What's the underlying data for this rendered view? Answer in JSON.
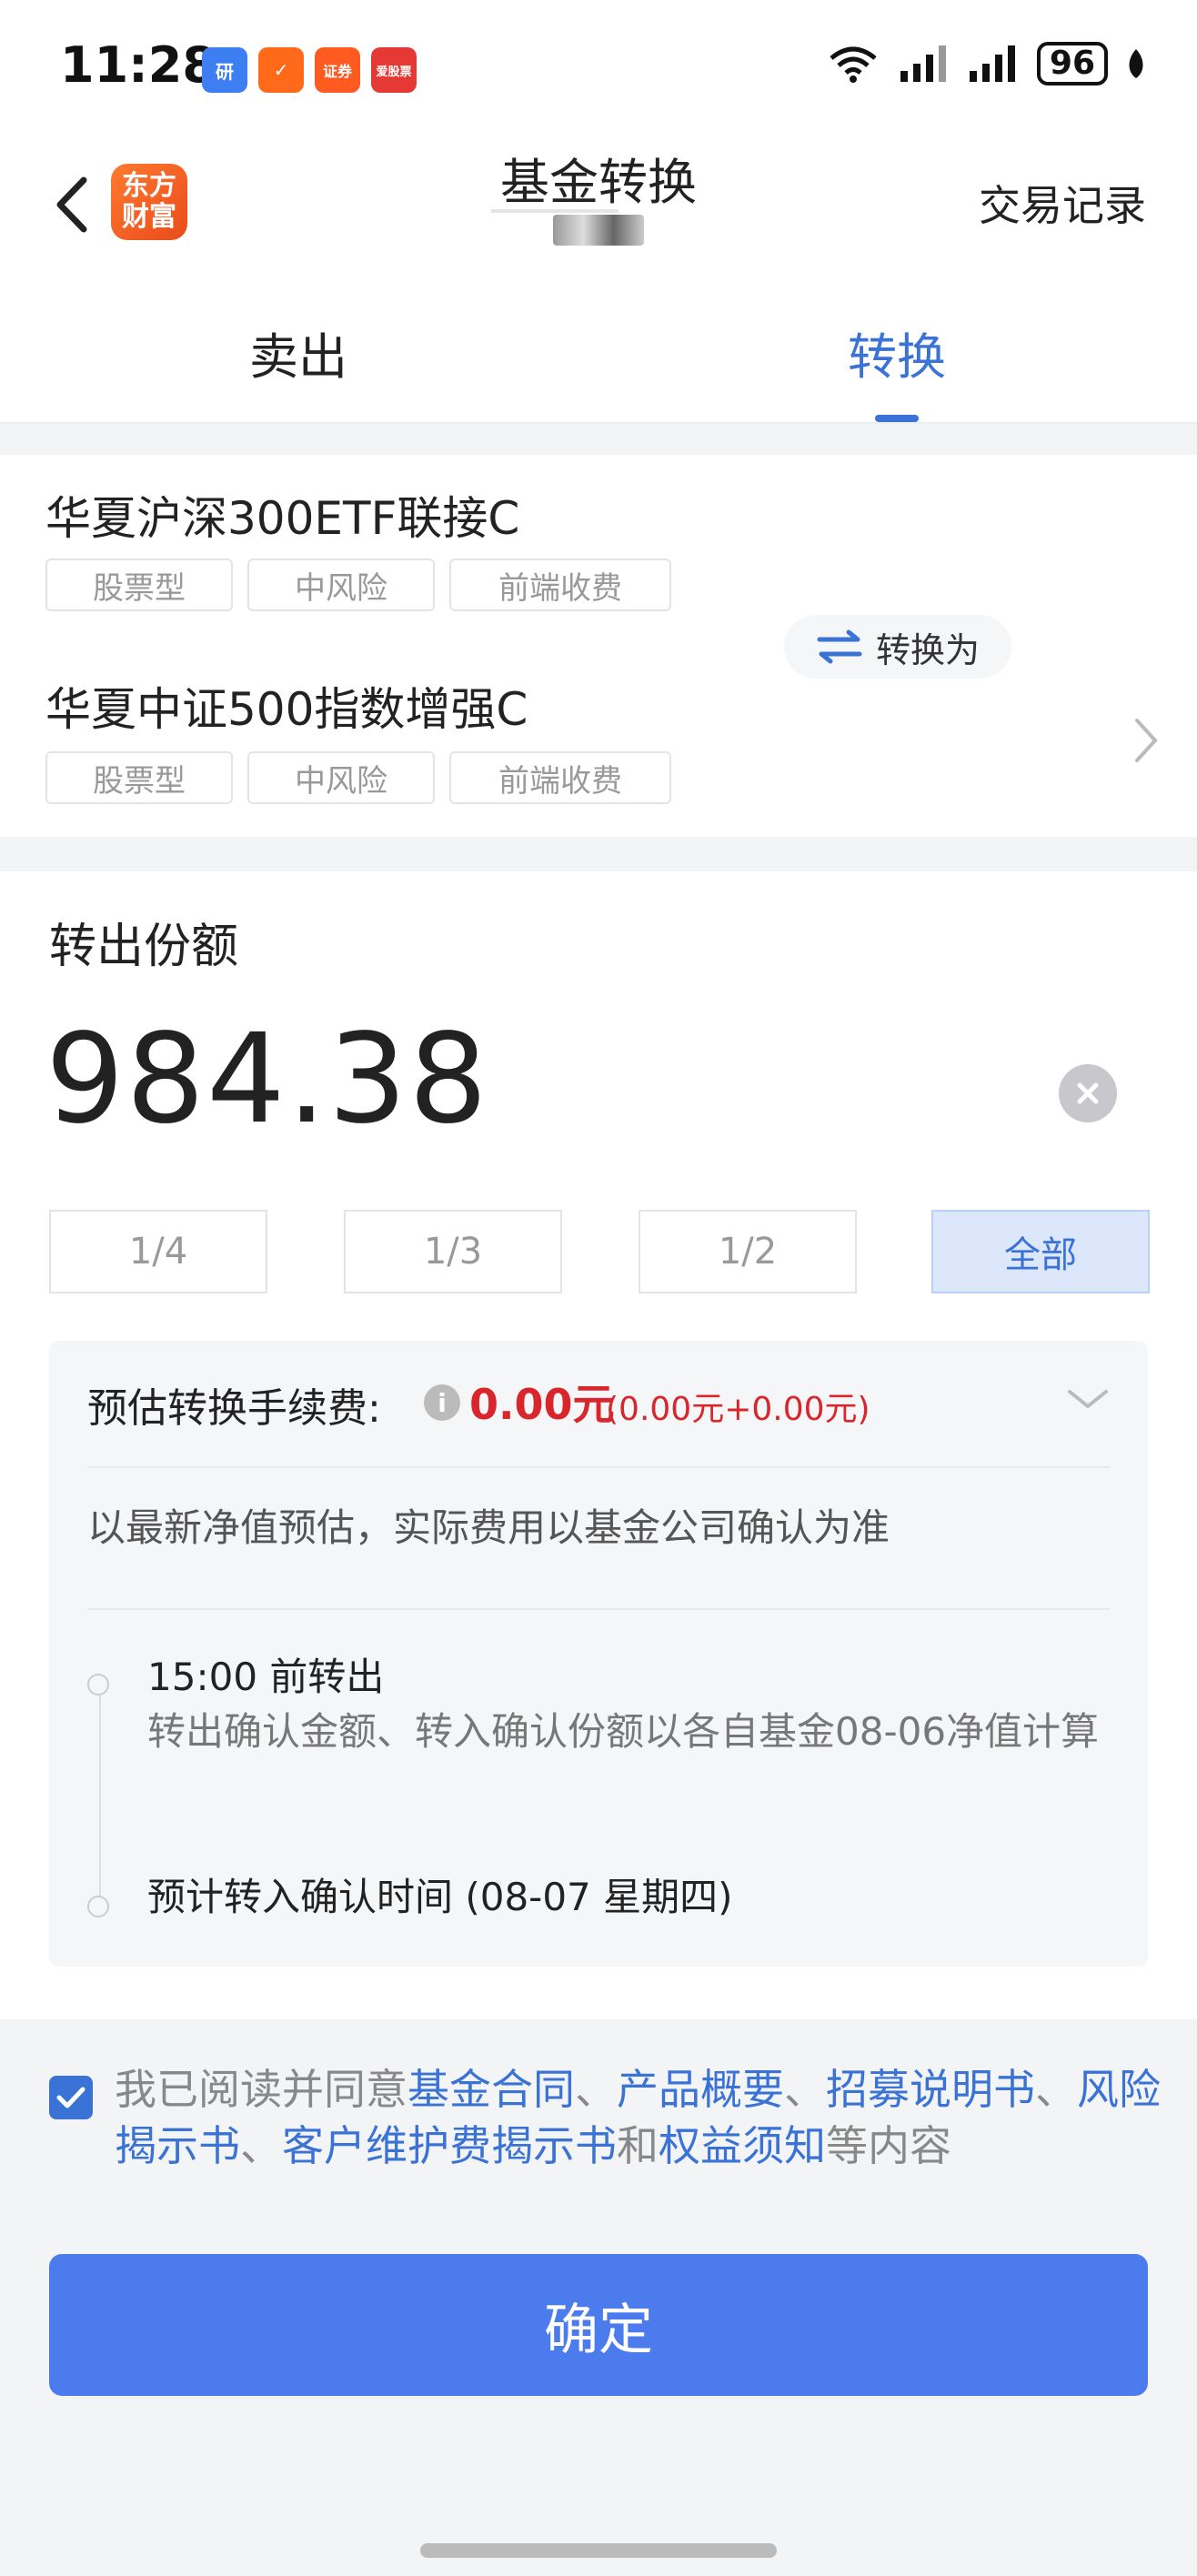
{
  "status_bar": {
    "time": "11:28",
    "battery": "96",
    "app_icons": [
      {
        "label": "研",
        "color": "#3d7ef2"
      },
      {
        "label": "✓",
        "color": "#ff6a1a"
      },
      {
        "label": "证券",
        "color": "#ff5a1f"
      },
      {
        "label": "爱股票",
        "color": "#e53935"
      }
    ]
  },
  "nav": {
    "logo_line1": "东方",
    "logo_line2": "财富",
    "title": "基金转换",
    "right_label": "交易记录"
  },
  "tabs": [
    {
      "label": "卖出"
    },
    {
      "label": "转换"
    }
  ],
  "fund_from": {
    "name": "华夏沪深300ETF联接C",
    "tags": [
      "股票型",
      "中风险",
      "前端收费"
    ]
  },
  "switch_label": "转换为",
  "fund_to": {
    "name": "华夏中证500指数增强C",
    "tags": [
      "股票型",
      "中风险",
      "前端收费"
    ]
  },
  "amount_section": {
    "label": "转出份额",
    "value": "984.38"
  },
  "quick_buttons": [
    "1/4",
    "1/3",
    "1/2",
    "全部"
  ],
  "fee": {
    "label": "预估转换手续费:",
    "value": "0.00元",
    "detail": "(0.00元+0.00元)",
    "note": "以最新净值预估，实际费用以基金公司确认为准"
  },
  "timeline": [
    {
      "title": "15:00 前转出",
      "desc": "转出确认金额、转入确认份额以各自基金08-06净值计算"
    },
    {
      "title": "预计转入确认时间 (08-07 星期四)"
    }
  ],
  "agreement": {
    "prefix": "我已阅读并同意",
    "links": [
      "基金合同",
      "产品概要",
      "招募说明书",
      "风险揭示书",
      "客户维护费揭示书",
      "权益须知"
    ],
    "sep": "、",
    "and": "和",
    "suffix": "等内容"
  },
  "confirm_label": "确定",
  "colors": {
    "accent": "#3a72d6",
    "button": "#4b7bec",
    "fee_red": "#d9252c"
  }
}
